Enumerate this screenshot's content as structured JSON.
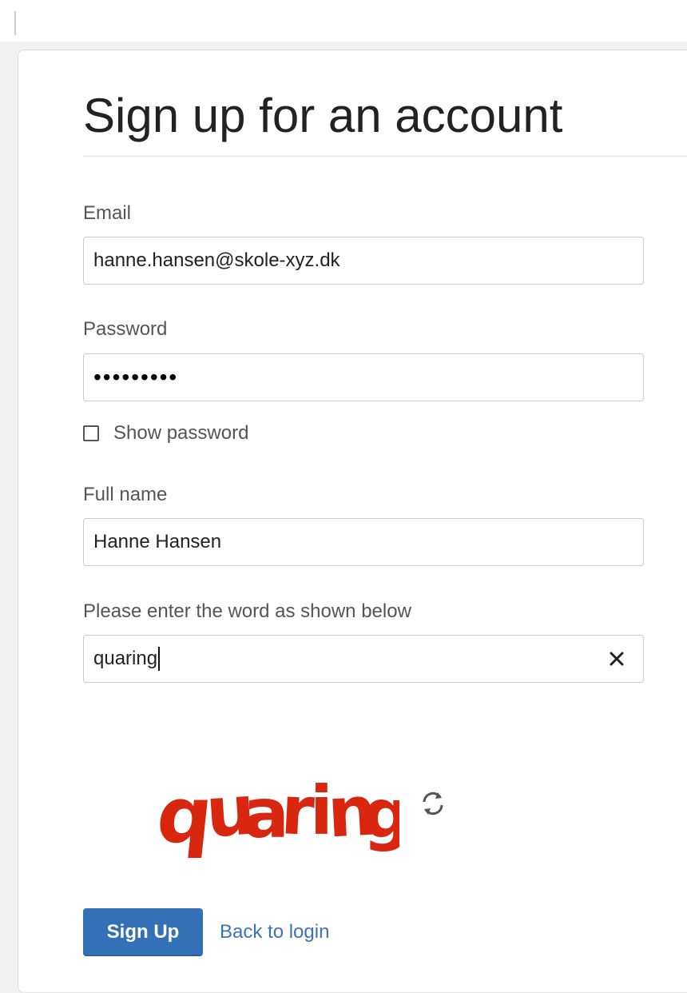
{
  "page": {
    "title": "Sign up for an account"
  },
  "form": {
    "email_label": "Email",
    "email_value": "hanne.hansen@skole-xyz.dk",
    "password_label": "Password",
    "password_value": "•••••••••",
    "show_password_label": "Show password",
    "show_password_checked": false,
    "fullname_label": "Full name",
    "fullname_value": "Hanne Hansen",
    "captcha_label": "Please enter the word as shown below",
    "captcha_value": "quaring",
    "clear_icon": "close-icon",
    "captcha_image_word": "quaring",
    "refresh_icon": "refresh-icon"
  },
  "actions": {
    "signup_label": "Sign Up",
    "back_label": "Back to login"
  },
  "colors": {
    "primary": "#3371b7",
    "link": "#3b73b9",
    "captcha_red": "#d9260f"
  }
}
